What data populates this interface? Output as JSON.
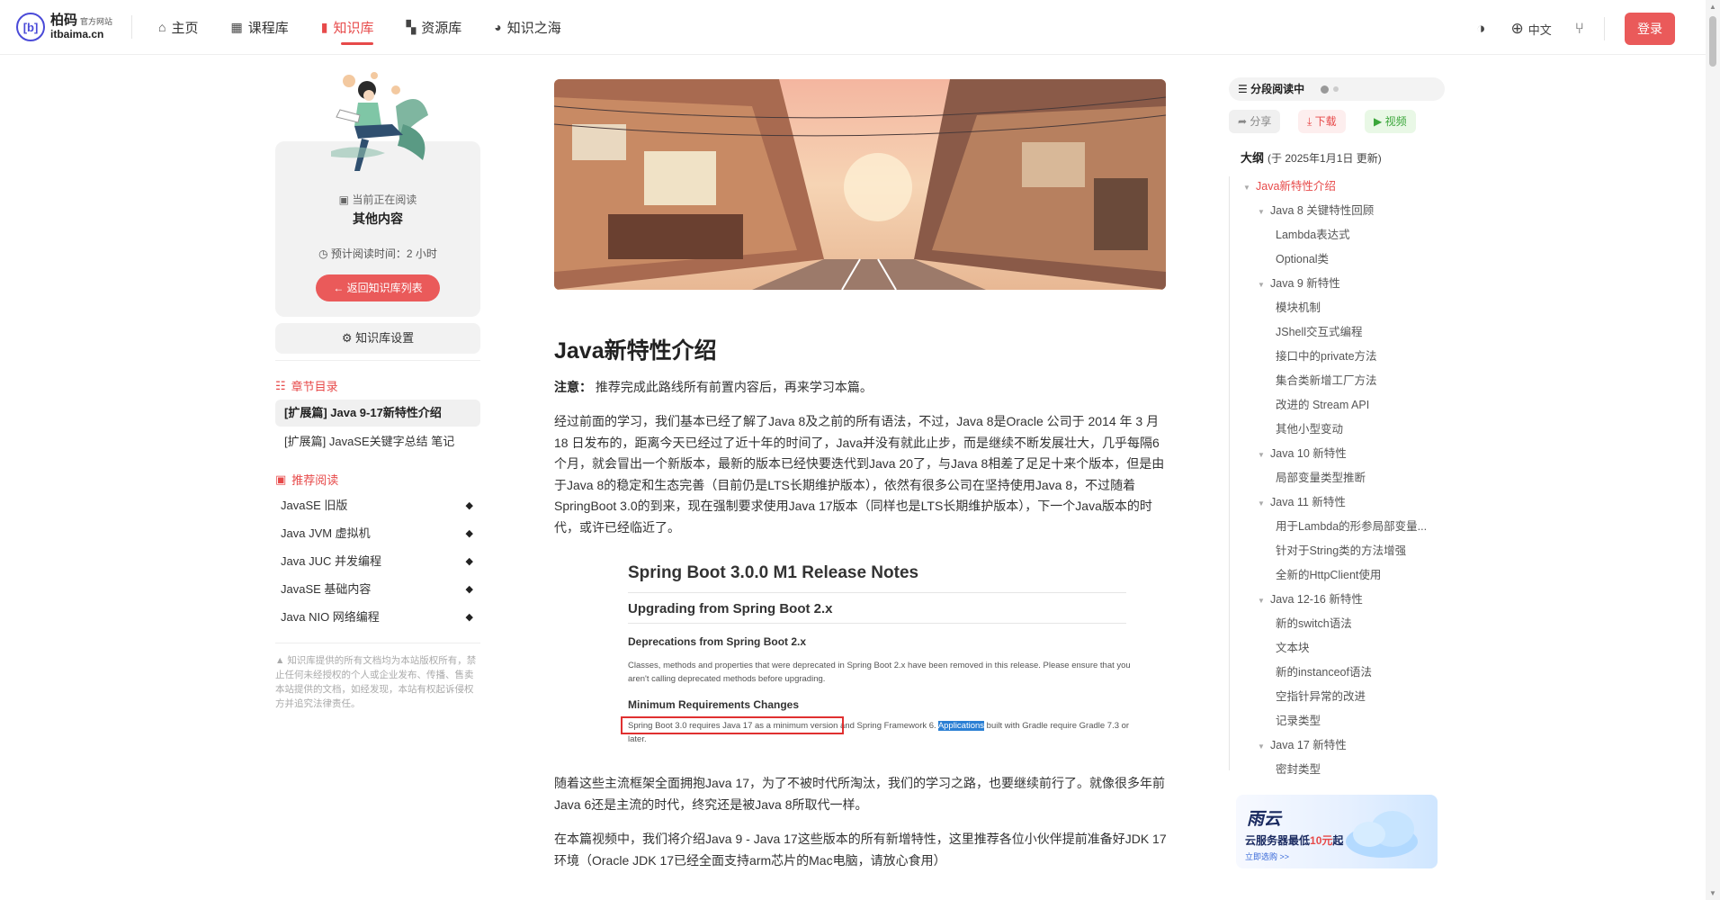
{
  "brand": {
    "logo_mark": "[b]",
    "name": "柏码",
    "tag": "官方网站",
    "domain": "itbaima.cn"
  },
  "nav": [
    {
      "label": "主页",
      "icon": "home-icon",
      "glyph": "⌂"
    },
    {
      "label": "课程库",
      "icon": "film-icon",
      "glyph": "▦"
    },
    {
      "label": "知识库",
      "icon": "book-icon",
      "glyph": "▮",
      "active": true
    },
    {
      "label": "资源库",
      "icon": "grid-icon",
      "glyph": "▚"
    },
    {
      "label": "知识之海",
      "icon": "globe-icon",
      "glyph": "◕"
    }
  ],
  "topright": {
    "theme_icon": "◑",
    "lang_icon": "⊕",
    "lang": "中文",
    "branch_icon": "⑂",
    "login": "登录"
  },
  "sidebar": {
    "reading_label": "当前正在阅读",
    "reading_title": "其他内容",
    "read_time": "预计阅读时间：2 小时",
    "back_button": "返回知识库列表",
    "settings": "知识库设置",
    "chapters_head": "章节目录",
    "chapters": [
      "[扩展篇] Java 9-17新特性介绍",
      "[扩展篇] JavaSE关键字总结 笔记"
    ],
    "recommend_head": "推荐阅读",
    "recommend": [
      "JavaSE 旧版",
      "Java JVM 虚拟机",
      "Java JUC 并发编程",
      "JavaSE 基础内容",
      "Java NIO 网络编程"
    ],
    "notice": "知识库提供的所有文档均为本站版权所有，禁止任何未经授权的个人或企业发布、传播、售卖本站提供的文档，如经发现，本站有权起诉侵权方并追究法律责任。"
  },
  "article": {
    "title": "Java新特性介绍",
    "note_label": "注意：",
    "note": "推荐完成此路线所有前置内容后，再来学习本篇。",
    "p1": "经过前面的学习，我们基本已经了解了Java 8及之前的所有语法，不过，Java 8是Oracle 公司于 2014 年 3 月 18 日发布的，距离今天已经过了近十年的时间了，Java并没有就此止步，而是继续不断发展壮大，几乎每隔6个月，就会冒出一个新版本，最新的版本已经快要迭代到Java 20了，与Java 8相差了足足十来个版本，但是由于Java 8的稳定和生态完善（目前仍是LTS长期维护版本），依然有很多公司在坚持使用Java 8，不过随着SpringBoot 3.0的到来，现在强制要求使用Java 17版本（同样也是LTS长期维护版本），下一个Java版本的时代，或许已经临近了。",
    "p2": "随着这些主流框架全面拥抱Java 17，为了不被时代所淘汰，我们的学习之路，也要继续前行了。就像很多年前Java 6还是主流的时代，终究还是被Java 8所取代一样。",
    "p3": "在本篇视频中，我们将介绍Java 9 - Java 17这些版本的所有新增特性，这里推荐各位小伙伴提前准备好JDK 17环境（Oracle JDK 17已经全面支持arm芯片的Mac电脑，请放心食用）"
  },
  "release": {
    "h1": "Spring Boot 3.0.0 M1 Release Notes",
    "h2": "Upgrading from Spring Boot 2.x",
    "h3a": "Deprecations from Spring Boot 2.x",
    "pa": "Classes, methods and properties that were deprecated in Spring Boot 2.x have been removed in this release. Please ensure that you aren't calling deprecated methods before upgrading.",
    "h3b": "Minimum Requirements Changes",
    "pb1": "Spring Boot 3.0 requires Java 17 as a minimum version",
    "pb2": " and Spring Framework 6. ",
    "pb_sel": "Applications",
    "pb3": " built with Gradle require Gradle 7.3 or later."
  },
  "right": {
    "reading_mode": "分段阅读中",
    "share": "分享",
    "download": "下载",
    "video": "视频",
    "outline_label": "大纲",
    "outline_date": "(于 2025年1月1日 更新)",
    "outline": [
      {
        "t": "Java新特性介绍",
        "lv": 0
      },
      {
        "t": "Java 8 关键特性回顾",
        "lv": 1
      },
      {
        "t": "Lambda表达式",
        "lv": 2
      },
      {
        "t": "Optional类",
        "lv": 2
      },
      {
        "t": "Java 9 新特性",
        "lv": 1
      },
      {
        "t": "模块机制",
        "lv": 2
      },
      {
        "t": "JShell交互式编程",
        "lv": 2
      },
      {
        "t": "接口中的private方法",
        "lv": 2
      },
      {
        "t": "集合类新增工厂方法",
        "lv": 2
      },
      {
        "t": "改进的 Stream API",
        "lv": 2
      },
      {
        "t": "其他小型变动",
        "lv": 2
      },
      {
        "t": "Java 10 新特性",
        "lv": 1
      },
      {
        "t": "局部变量类型推断",
        "lv": 2
      },
      {
        "t": "Java 11 新特性",
        "lv": 1
      },
      {
        "t": "用于Lambda的形参局部变量...",
        "lv": 2
      },
      {
        "t": "针对于String类的方法增强",
        "lv": 2
      },
      {
        "t": "全新的HttpClient使用",
        "lv": 2
      },
      {
        "t": "Java 12-16 新特性",
        "lv": 1
      },
      {
        "t": "新的switch语法",
        "lv": 2
      },
      {
        "t": "文本块",
        "lv": 2
      },
      {
        "t": "新的instanceof语法",
        "lv": 2
      },
      {
        "t": "空指针异常的改进",
        "lv": 2
      },
      {
        "t": "记录类型",
        "lv": 2
      },
      {
        "t": "Java 17 新特性",
        "lv": 1
      },
      {
        "t": "密封类型",
        "lv": 2
      }
    ],
    "ad_title": "雨云",
    "ad_sub_a": "云服务器最低",
    "ad_sub_red": "10元",
    "ad_sub_b": "起",
    "ad_link": "立即选购 >>"
  },
  "colors": {
    "accent": "#e74a4a",
    "green": "#3aa63a"
  }
}
